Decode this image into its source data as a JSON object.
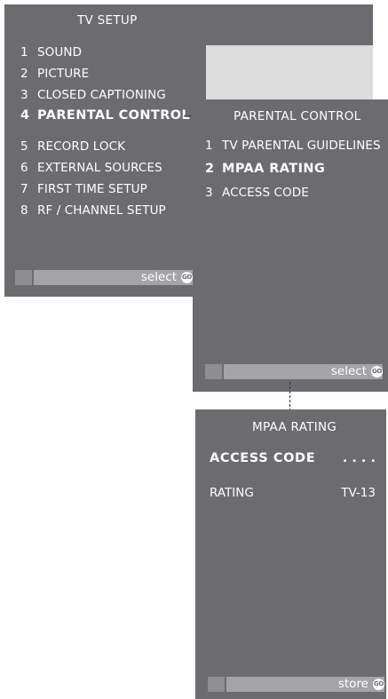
{
  "tv_setup": {
    "title": "TV  SETUP",
    "items": [
      {
        "num": "1",
        "label": "SOUND"
      },
      {
        "num": "2",
        "label": "PICTURE"
      },
      {
        "num": "3",
        "label": "CLOSED CAPTIONING"
      },
      {
        "num": "4",
        "label": "PARENTAL CONTROL"
      },
      {
        "num": "5",
        "label": "RECORD LOCK"
      },
      {
        "num": "6",
        "label": "EXTERNAL SOURCES"
      },
      {
        "num": "7",
        "label": "FIRST TIME SETUP"
      },
      {
        "num": "8",
        "label": "RF / CHANNEL SETUP"
      }
    ],
    "bar_label": "select",
    "go_label": "GO"
  },
  "parental_control": {
    "title": "PARENTAL CONTROL",
    "items": [
      {
        "num": "1",
        "label": "TV PARENTAL GUIDELINES"
      },
      {
        "num": "2",
        "label": "MPAA RATING"
      },
      {
        "num": "3",
        "label": "ACCESS CODE"
      }
    ],
    "bar_label": "select",
    "go_label": "GO"
  },
  "mpaa_rating": {
    "title": "MPAA  RATING",
    "access_code_label": "ACCESS  CODE",
    "access_code_value": ". . . .",
    "rating_label": "RATING",
    "rating_value": "TV-13",
    "bar_label": "store",
    "go_label": "GO"
  },
  "colors": {
    "panel": "#6b6b70",
    "text": "#ffffff",
    "bar": "#a3a3a8",
    "highlight_area": "#dcdcdc"
  }
}
